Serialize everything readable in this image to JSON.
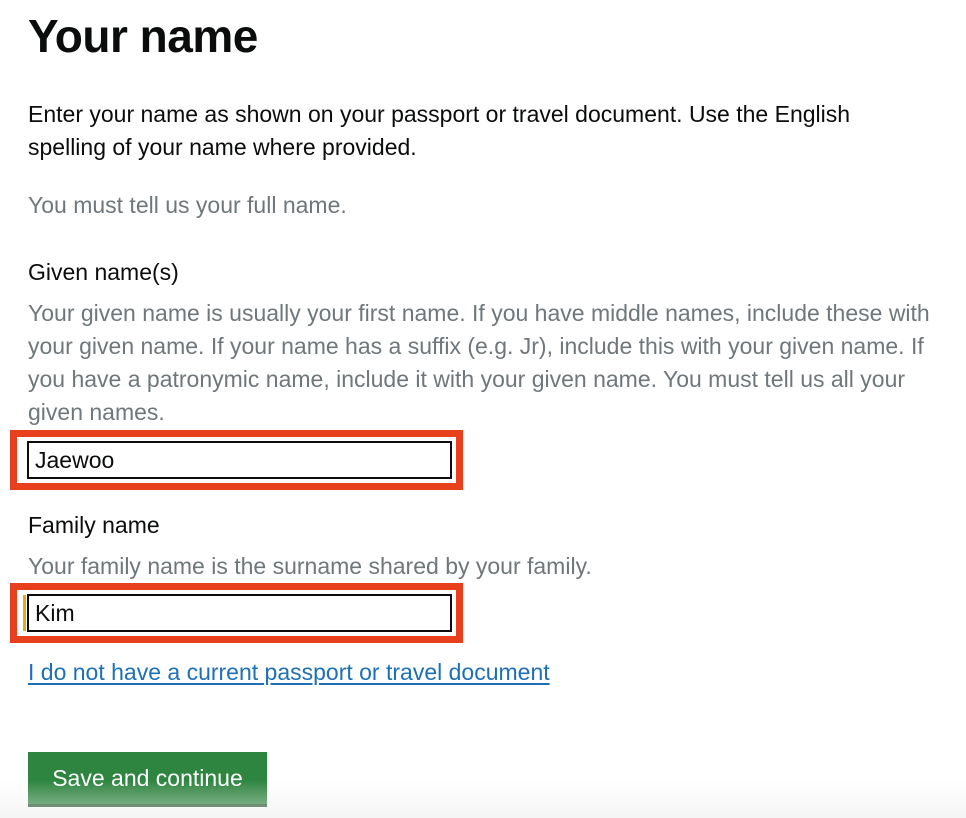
{
  "page": {
    "title": "Your name",
    "intro": "Enter your name as shown on your passport or travel document. Use the English spelling of your name where provided.",
    "required_hint": "You must tell us your full name."
  },
  "given_name": {
    "label": "Given name(s)",
    "hint": "Your given name is usually your first name. If you have middle names, include these with your given name. If your name has a suffix (e.g. Jr), include this with your given name. If you have a patronymic name, include it with your given name. You must tell us all your given names.",
    "value": "Jaewoo"
  },
  "family_name": {
    "label": "Family name",
    "hint": "Your family name is the surname shared by your family.",
    "value": "Kim"
  },
  "links": {
    "no_passport": "I do not have a current passport or travel document"
  },
  "actions": {
    "save_label": "Save and continue"
  },
  "colors": {
    "highlight_border": "#e8401c",
    "focus_bar": "#f2a516",
    "link": "#1d70b8",
    "button": "#2e8540",
    "hint_text": "#6f777b"
  }
}
